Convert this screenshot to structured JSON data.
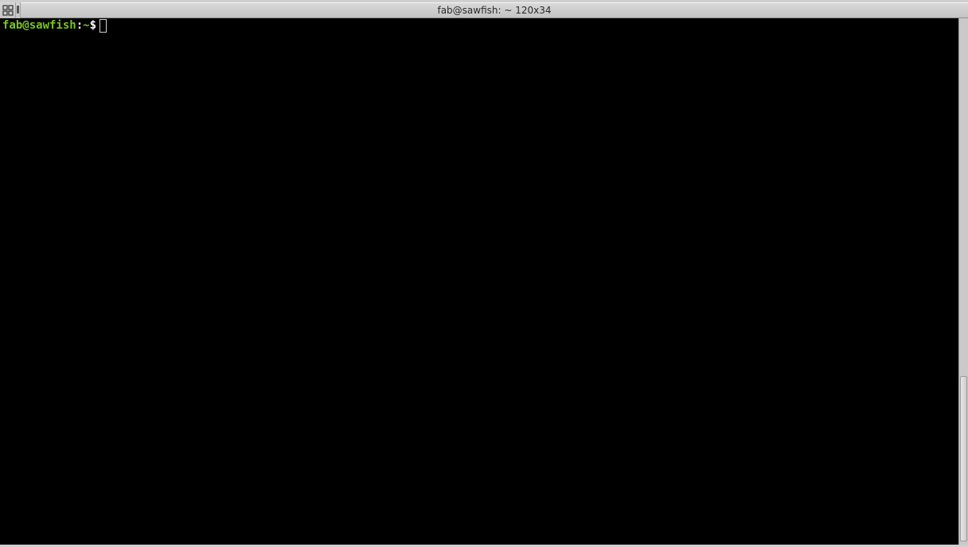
{
  "window": {
    "title": "fab@sawfish: ~ 120x34"
  },
  "terminal": {
    "prompt": {
      "userhost": "fab@sawfish",
      "sep": ":",
      "path": "~",
      "dollar": "$"
    }
  }
}
